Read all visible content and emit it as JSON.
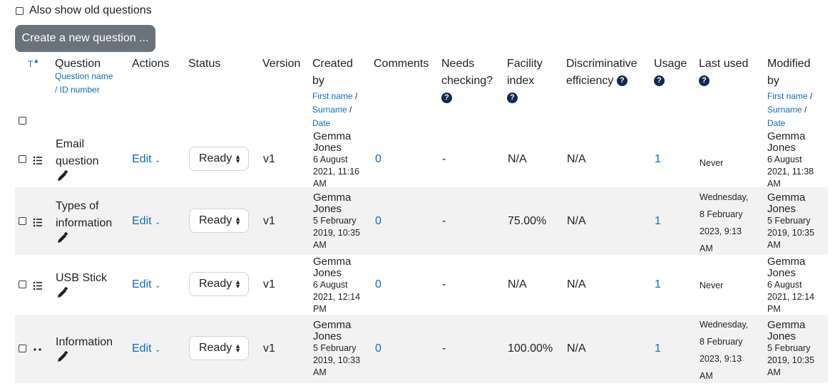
{
  "options": {
    "also_show_old_label": "Also show old questions"
  },
  "create_button_label": "Create a new question ...",
  "headers": {
    "type": "T",
    "question": "Question",
    "question_sub1": "Question name",
    "question_sub2": "/ ID number",
    "actions": "Actions",
    "status": "Status",
    "version": "Version",
    "created_by_1": "Created",
    "created_by_2": "by",
    "created_sub_first": "First name",
    "created_sub_sep1": " /",
    "created_sub_surname": "Surname",
    "created_sub_sep2": " /",
    "created_sub_date": "Date",
    "comments": "Comments",
    "needs_checking_1": "Needs",
    "needs_checking_2": "checking?",
    "facility_1": "Facility",
    "facility_2": "index",
    "discrim_1": "Discriminative",
    "discrim_2": "efficiency",
    "usage": "Usage",
    "last_used": "Last used",
    "modified_1": "Modified",
    "modified_2": "by",
    "modified_sub_first": "First name",
    "modified_sub_sep1": " /",
    "modified_sub_surname": "Surname",
    "modified_sub_sep2": " /",
    "modified_sub_date": "Date",
    "help_symbol": "?"
  },
  "rows": [
    {
      "name_1": "Email",
      "name_2": "question",
      "edit": "Edit",
      "status": "Ready",
      "version": "v1",
      "created_name_1": "Gemma",
      "created_name_2": "Jones",
      "created_date_1": "6 August",
      "created_date_2": "2021, 11:16",
      "created_date_3": "AM",
      "comments": "0",
      "needs_checking": "-",
      "facility": "N/A",
      "discrim": "N/A",
      "usage": "1",
      "last_used_1": "Never",
      "last_used_2": "",
      "last_used_3": "",
      "last_used_4": "",
      "modified_name_1": "Gemma",
      "modified_name_2": "Jones",
      "modified_date_1": "6 August",
      "modified_date_2": "2021, 11:38",
      "modified_date_3": "AM",
      "type_icon": "multichoice-list-icon"
    },
    {
      "name_1": "Types of",
      "name_2": "information",
      "edit": "Edit",
      "status": "Ready",
      "version": "v1",
      "created_name_1": "Gemma",
      "created_name_2": "Jones",
      "created_date_1": "5 February",
      "created_date_2": "2019, 10:35",
      "created_date_3": "AM",
      "comments": "0",
      "needs_checking": "-",
      "facility": "75.00%",
      "discrim": "N/A",
      "usage": "1",
      "last_used_1": "Wednesday,",
      "last_used_2": "8 February",
      "last_used_3": "2023, 9:13",
      "last_used_4": "AM",
      "modified_name_1": "Gemma",
      "modified_name_2": "Jones",
      "modified_date_1": "5 February",
      "modified_date_2": "2019, 10:35",
      "modified_date_3": "AM",
      "type_icon": "multichoice-list-icon"
    },
    {
      "name_1": "USB Stick",
      "name_2": "",
      "edit": "Edit",
      "status": "Ready",
      "version": "v1",
      "created_name_1": "Gemma",
      "created_name_2": "Jones",
      "created_date_1": "6 August",
      "created_date_2": "2021, 12:14",
      "created_date_3": "PM",
      "comments": "0",
      "needs_checking": "-",
      "facility": "N/A",
      "discrim": "N/A",
      "usage": "1",
      "last_used_1": "Never",
      "last_used_2": "",
      "last_used_3": "",
      "last_used_4": "",
      "modified_name_1": "Gemma",
      "modified_name_2": "Jones",
      "modified_date_1": "6 August",
      "modified_date_2": "2021, 12:14",
      "modified_date_3": "PM",
      "type_icon": "multichoice-list-icon"
    },
    {
      "name_1": "Information",
      "name_2": "",
      "edit": "Edit",
      "status": "Ready",
      "version": "v1",
      "created_name_1": "Gemma",
      "created_name_2": "Jones",
      "created_date_1": "5 February",
      "created_date_2": "2019, 10:33",
      "created_date_3": "AM",
      "comments": "0",
      "needs_checking": "-",
      "facility": "100.00%",
      "discrim": "N/A",
      "usage": "1",
      "last_used_1": "Wednesday,",
      "last_used_2": "8 February",
      "last_used_3": "2023, 9:13",
      "last_used_4": "AM",
      "modified_name_1": "Gemma",
      "modified_name_2": "Jones",
      "modified_date_1": "5 February",
      "modified_date_2": "2019, 10:35",
      "modified_date_3": "AM",
      "type_icon": "description-dots-icon"
    }
  ]
}
